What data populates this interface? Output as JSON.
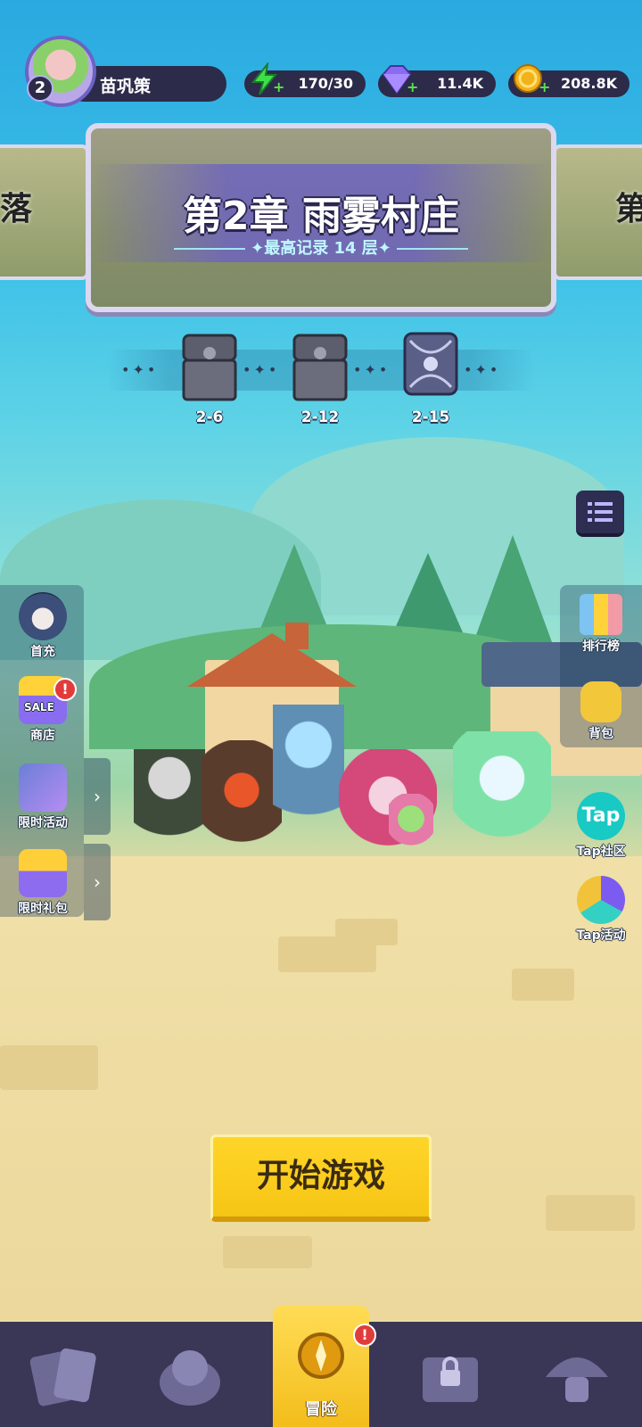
{
  "player": {
    "name": "苗巩策",
    "level": "2"
  },
  "resources": {
    "energy": "170/30",
    "gems": "11.4K",
    "coins": "208.8K",
    "plus": "+"
  },
  "chapter": {
    "title": "第2章 雨雾村庄",
    "record": "最高记录 14 层",
    "prev_fragment": "落",
    "next_fragment": "第"
  },
  "chests": [
    {
      "label": "2-6"
    },
    {
      "label": "2-12"
    },
    {
      "label": "2-15"
    }
  ],
  "left_buttons": [
    {
      "label": "首充"
    },
    {
      "label": "商店",
      "badge": "!"
    },
    {
      "label": "限时活动"
    },
    {
      "label": "限时礼包"
    }
  ],
  "right_buttons": [
    {
      "label": "排行榜"
    },
    {
      "label": "背包"
    },
    {
      "label": "Tap社区"
    },
    {
      "label": "Tap活动"
    }
  ],
  "shop_sale_tag": "SALE",
  "tap_logo": "Tap",
  "start_button": "开始游戏",
  "bottom_nav": {
    "active_label": "冒险",
    "active_badge": "!"
  },
  "colors": {
    "accent": "#f6c514",
    "panel": "#2c2b4a",
    "energy": "#3ee04a",
    "gem": "#8a6cf0",
    "coin": "#f4b21a"
  }
}
